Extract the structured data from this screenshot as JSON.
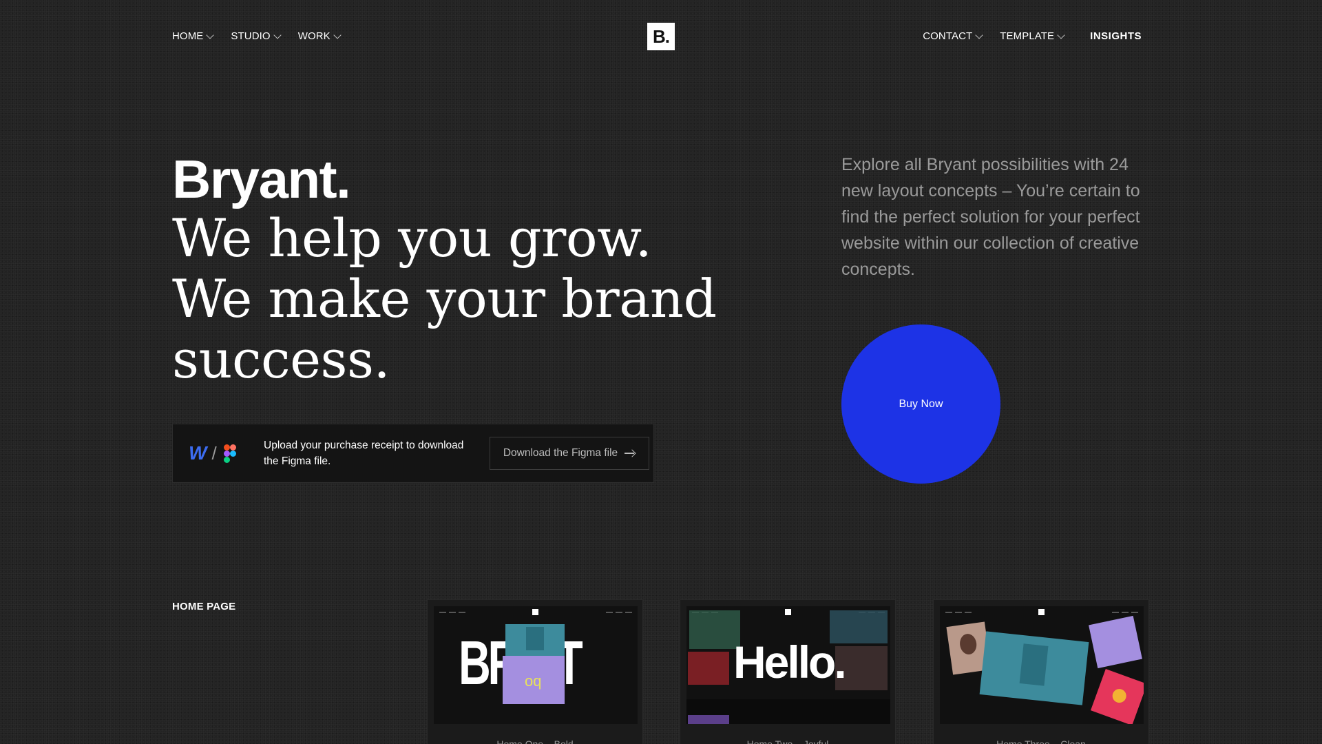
{
  "nav": {
    "left": [
      {
        "label": "HOME"
      },
      {
        "label": "STUDIO"
      },
      {
        "label": "WORK"
      }
    ],
    "logo": "B.",
    "right": [
      {
        "label": "CONTACT"
      },
      {
        "label": "TEMPLATE"
      },
      {
        "label": "INSIGHTS"
      }
    ]
  },
  "hero": {
    "title": "Bryant.",
    "lines": [
      "We help you grow.",
      "We make your brand",
      "success."
    ],
    "intro": "Explore all Bryant possibilities with 24 new layout concepts – You’re certain to find the perfect solution for your perfect website within our collection of creative concepts.",
    "buy_label": "Buy Now",
    "buy_color": "#1d33e6"
  },
  "download": {
    "text": "Upload your purchase receipt to download the Figma file.",
    "button_label": "Download the Figma file",
    "icons": [
      "webflow-icon",
      "figma-icon",
      "arrow-right-icon"
    ]
  },
  "homepages": {
    "section_label": "HOME PAGE",
    "cards": [
      {
        "caption": "Home One – Bold",
        "preview_word": "BR  NT"
      },
      {
        "caption": "Home Two – Joyful",
        "preview_word": "Hello."
      },
      {
        "caption": "Home Three – Clean"
      }
    ]
  }
}
